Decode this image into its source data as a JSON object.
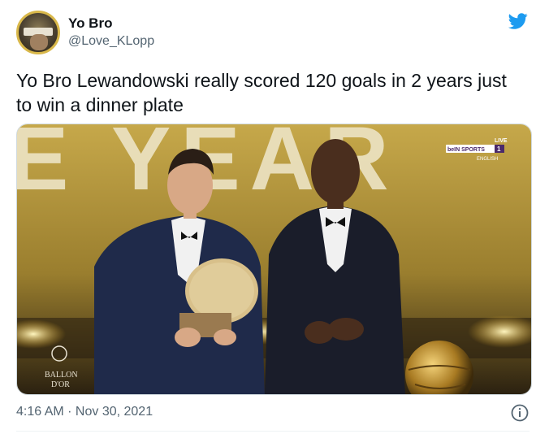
{
  "author": {
    "display_name": "Yo Bro",
    "handle": "@Love_KLopp"
  },
  "tweet": {
    "text": "Yo Bro Lewandowski really scored 120 goals in 2 years just to win a dinner plate",
    "timestamp": "4:16 AM · Nov 30, 2021"
  },
  "media": {
    "backdrop_text": "E YEAR",
    "channel_logo": "beIN SPORTS",
    "channel_number": "1",
    "live_label": "LIVE",
    "language_label": "ENGLISH",
    "trophy_text_1": "BALLON",
    "trophy_text_2": "D'OR"
  },
  "icons": {
    "brand": "twitter-bird-icon",
    "info": "info-icon"
  },
  "colors": {
    "twitter_blue": "#1d9bf0",
    "secondary_text": "#536471",
    "stage_gold": "#b89a3c"
  }
}
